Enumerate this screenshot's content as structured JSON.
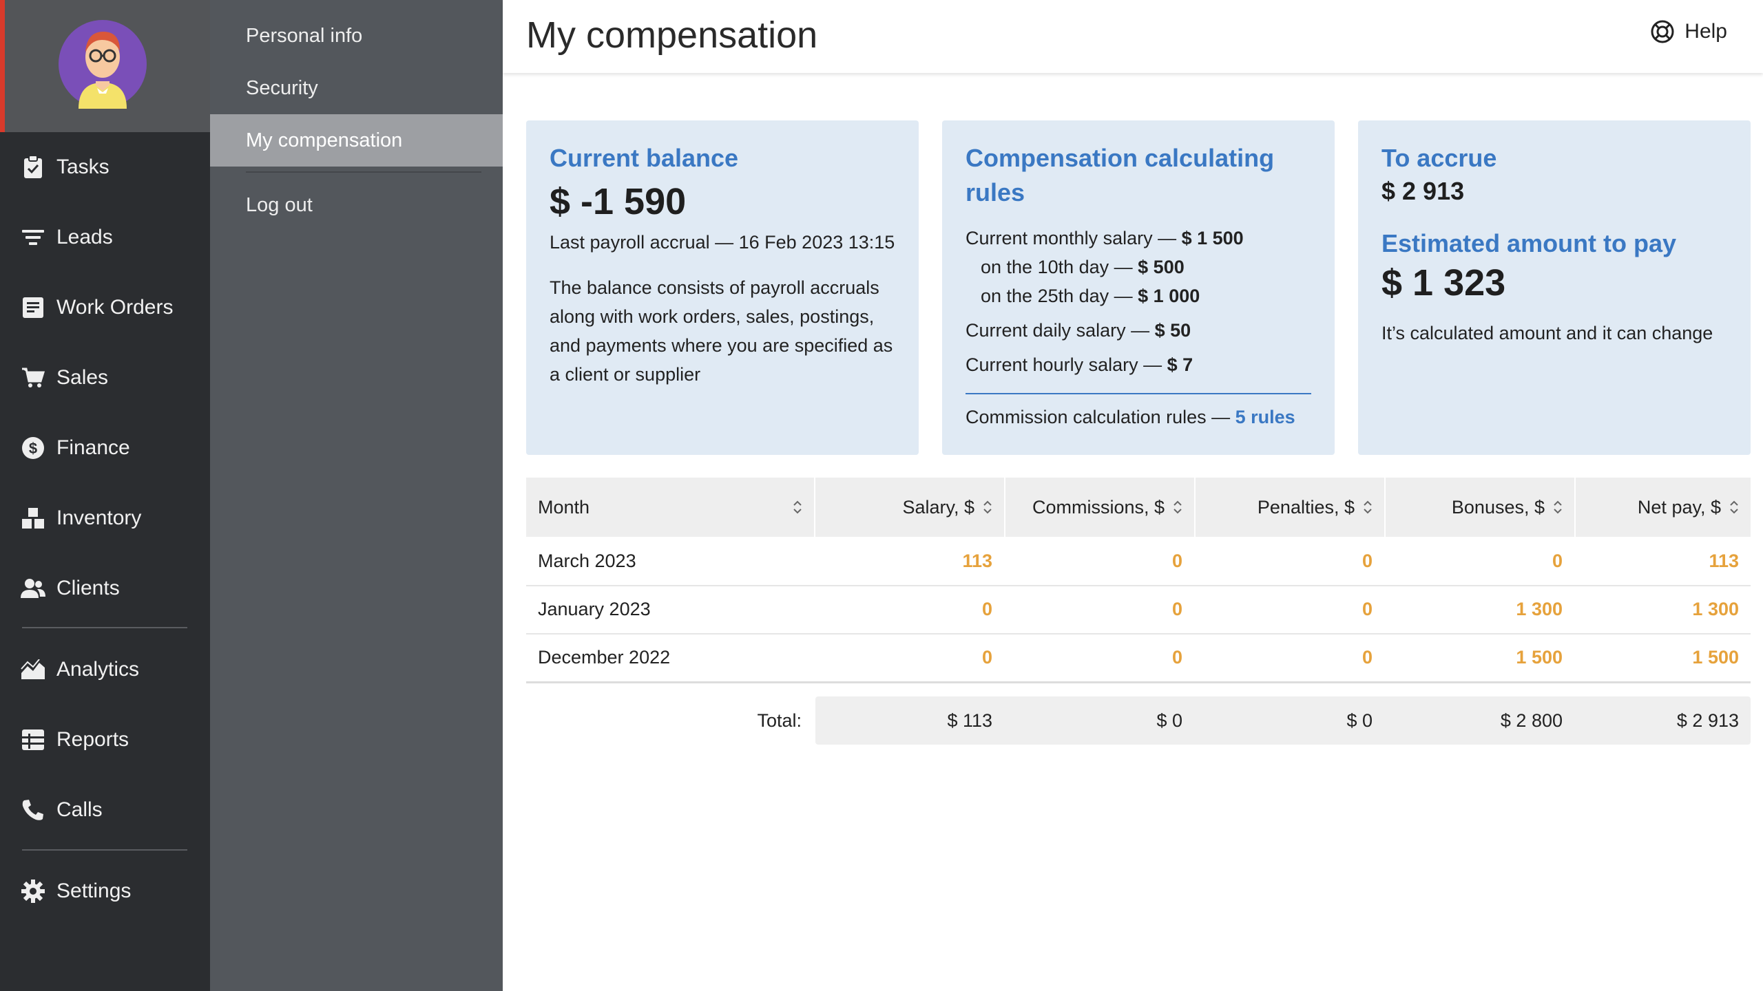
{
  "nav": {
    "items": [
      {
        "label": "Tasks",
        "icon": "clipboard-check-icon"
      },
      {
        "label": "Leads",
        "icon": "filter-icon"
      },
      {
        "label": "Work Orders",
        "icon": "work-order-icon"
      },
      {
        "label": "Sales",
        "icon": "cart-icon"
      },
      {
        "label": "Finance",
        "icon": "dollar-icon"
      },
      {
        "label": "Inventory",
        "icon": "boxes-icon"
      },
      {
        "label": "Clients",
        "icon": "users-icon"
      },
      {
        "label": "Analytics",
        "icon": "area-chart-icon"
      },
      {
        "label": "Reports",
        "icon": "table-icon"
      },
      {
        "label": "Calls",
        "icon": "phone-icon"
      },
      {
        "label": "Settings",
        "icon": "gear-icon"
      }
    ]
  },
  "submenu": {
    "items": [
      {
        "label": "Personal info"
      },
      {
        "label": "Security"
      },
      {
        "label": "My compensation",
        "active": true
      },
      {
        "label": "Log out"
      }
    ]
  },
  "header": {
    "title": "My compensation",
    "help_label": "Help"
  },
  "cards": {
    "balance": {
      "title": "Current balance",
      "amount": "$ -1 590",
      "last_accrual": "Last payroll accrual — 16 Feb 2023 13:15",
      "description": "The balance consists of payroll accruals along with work orders, sales, postings, and payments where you are specified as a client or supplier"
    },
    "rules": {
      "title": "Compensation calculating rules",
      "monthly_label": "Current monthly salary — ",
      "monthly_value": "$ 1 500",
      "day10_label": "on the 10th day — ",
      "day10_value": "$ 500",
      "day25_label": "on the 25th day — ",
      "day25_value": "$ 1 000",
      "daily_label": "Current daily salary — ",
      "daily_value": "$ 50",
      "hourly_label": "Current hourly salary — ",
      "hourly_value": "$ 7",
      "commission_label": "Commission calculation rules — ",
      "commission_link": "5 rules"
    },
    "accrue": {
      "title": "To accrue",
      "amount": "$ 2 913",
      "estimated_title": "Estimated amount to pay",
      "estimated_amount": "$ 1 323",
      "note": "It’s calculated amount and it can change"
    }
  },
  "table": {
    "columns": [
      "Month",
      "Salary, $",
      "Commissions, $",
      "Penalties, $",
      "Bonuses, $",
      "Net pay, $"
    ],
    "rows": [
      {
        "month": "March 2023",
        "salary": "113",
        "commissions": "0",
        "penalties": "0",
        "bonuses": "0",
        "net": "113"
      },
      {
        "month": "January 2023",
        "salary": "0",
        "commissions": "0",
        "penalties": "0",
        "bonuses": "1 300",
        "net": "1 300"
      },
      {
        "month": "December 2022",
        "salary": "0",
        "commissions": "0",
        "penalties": "0",
        "bonuses": "1 500",
        "net": "1 500"
      }
    ],
    "total_label": "Total:",
    "totals": {
      "salary": "$ 113",
      "commissions": "$ 0",
      "penalties": "$ 0",
      "bonuses": "$ 2 800",
      "net": "$ 2 913"
    }
  },
  "colors": {
    "nav_bg": "#2b2d30",
    "submenu_bg": "#53575c",
    "card_bg": "#e0eaf4",
    "accent_blue": "#3a78c3",
    "value_orange": "#e6a23c",
    "avatar_red_edge": "#d93a2b"
  }
}
